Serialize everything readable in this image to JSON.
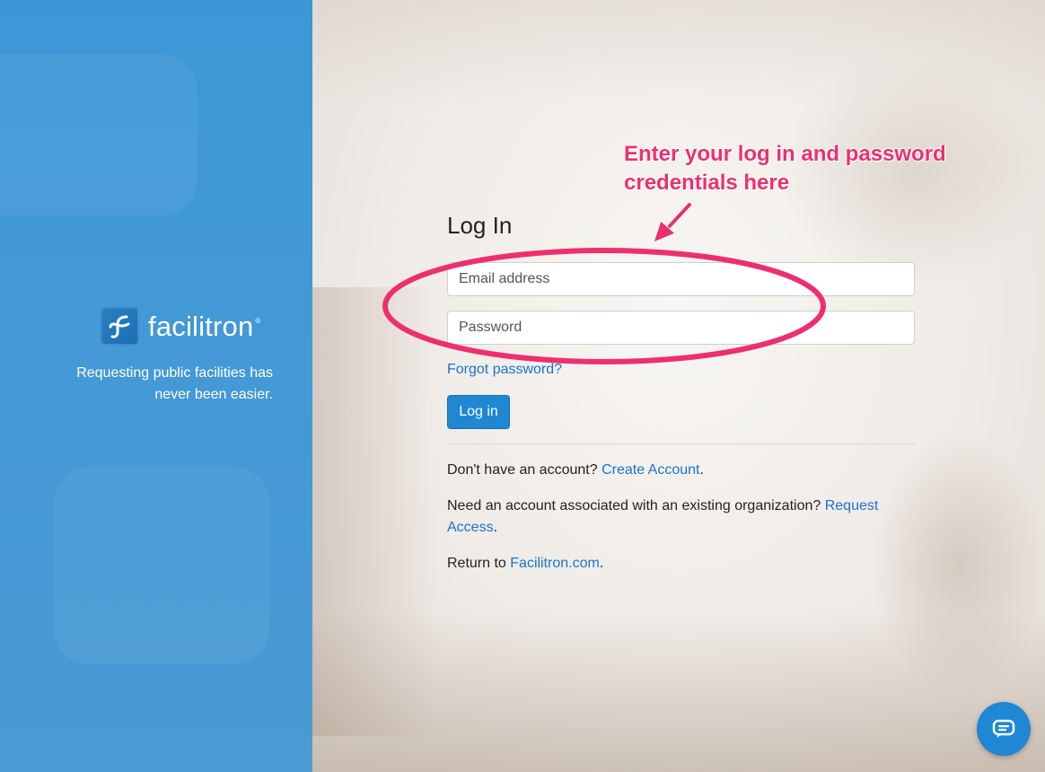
{
  "brand": {
    "name": "facilitron",
    "registered_mark": "®",
    "tagline": "Requesting public facilities has never been easier."
  },
  "login": {
    "title": "Log In",
    "email_placeholder": "Email address",
    "password_placeholder": "Password",
    "forgot_link": "Forgot password?",
    "login_button": "Log in"
  },
  "footer_links": {
    "no_account_text": "Don't have an account?",
    "create_account_link": "Create Account",
    "period": ".",
    "existing_org_text": "Need an account associated with an existing organization?",
    "request_access_link": "Request Access",
    "return_text": "Return to",
    "facilitron_link": "Facilitron.com"
  },
  "annotation": {
    "text": "Enter your log in and password credentials here"
  },
  "colors": {
    "left_panel": "#4399d6",
    "primary_button": "#1f88d1",
    "link": "#1a73d4",
    "annotation": "#ee2f6f"
  },
  "icons": {
    "logo": "facilitron-f-logo-icon",
    "chat": "chat-bubble-icon"
  }
}
